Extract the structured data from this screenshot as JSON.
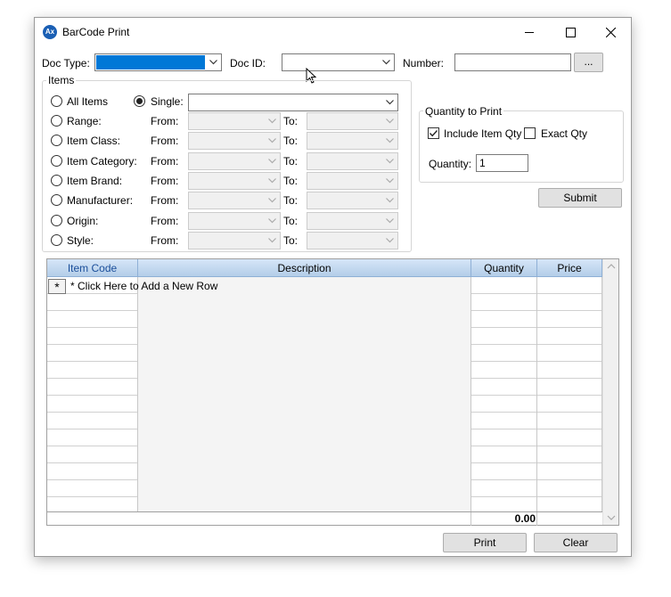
{
  "window": {
    "title": "BarCode Print",
    "icon_text": "Ax"
  },
  "top": {
    "doc_type_label": "Doc Type:",
    "doc_id_label": "Doc ID:",
    "number_label": "Number:",
    "number_value": "",
    "ellipsis_label": "..."
  },
  "items": {
    "group_title": "Items",
    "all_items_label": "All Items",
    "single_label": "Single:",
    "from_label": "From:",
    "to_label": "To:",
    "filters": [
      {
        "label": "Range:"
      },
      {
        "label": "Item Class:"
      },
      {
        "label": "Item Category:"
      },
      {
        "label": "Item Brand:"
      },
      {
        "label": "Manufacturer:"
      },
      {
        "label": "Origin:"
      },
      {
        "label": "Style:"
      }
    ]
  },
  "quantity": {
    "group_title": "Quantity to Print",
    "include_item_qty_label": "Include Item Qty",
    "include_item_qty_checked": true,
    "exact_qty_label": "Exact Qty",
    "exact_qty_checked": false,
    "quantity_label": "Quantity:",
    "quantity_value": "1"
  },
  "submit_label": "Submit",
  "grid": {
    "columns": [
      "Item Code",
      "Description",
      "Quantity",
      "Price"
    ],
    "new_row_marker": "*",
    "new_row_text": "* Click Here to Add a New Row",
    "total_quantity": "0.00"
  },
  "footer": {
    "print_label": "Print",
    "clear_label": "Clear"
  }
}
